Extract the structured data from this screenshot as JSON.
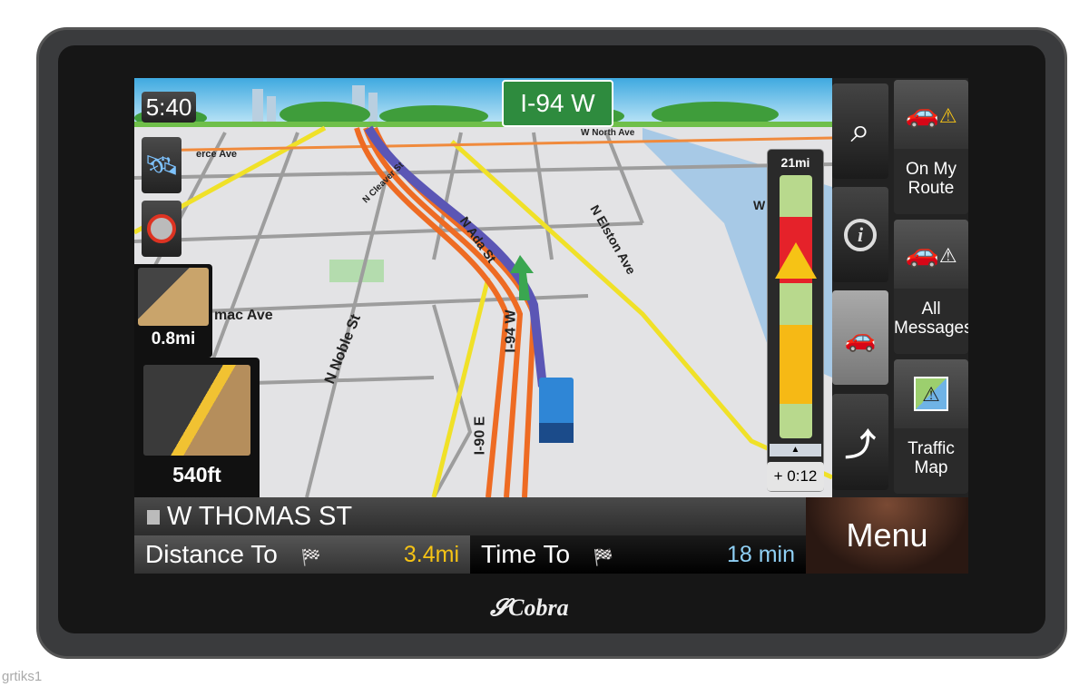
{
  "device": {
    "brand": "Cobra"
  },
  "watermark": "grtiks1",
  "map": {
    "highway_sign": "I-94 W",
    "clock": "5:40",
    "street_labels": [
      "erce Ave",
      "W North Ave",
      "N Cleaver St",
      "N Ada St",
      "N Elston Ave",
      "N Noble St",
      "mac Ave",
      "I-94 W",
      "I-90 E",
      "W"
    ]
  },
  "lane_guidance": {
    "small_distance": "0.8mi",
    "large_distance": "540ft"
  },
  "traffic_bar": {
    "distance": "21mi",
    "delay": "+ 0:12",
    "colors": {
      "clear": "#b8d98d",
      "heavy": "#e5222a",
      "moderate": "#f6b915"
    }
  },
  "side_buttons": {
    "search": "search-icon",
    "info": "info-icon",
    "traffic_car": "car-detour-icon",
    "route": "route-icon"
  },
  "right_panel": [
    {
      "label_line1": "On My",
      "label_line2": "Route",
      "icon": "car-warning-icon"
    },
    {
      "label_line1": "All",
      "label_line2": "Messages",
      "icon": "car-warning-icon"
    },
    {
      "label_line1": "Traffic",
      "label_line2": "Map",
      "icon": "map-warning-icon"
    }
  ],
  "bottom_bar": {
    "current_street": "W THOMAS ST",
    "distance_label": "Distance To",
    "distance_value": "3.4mi",
    "time_label": "Time To",
    "time_value": "18 min",
    "menu_label": "Menu"
  }
}
